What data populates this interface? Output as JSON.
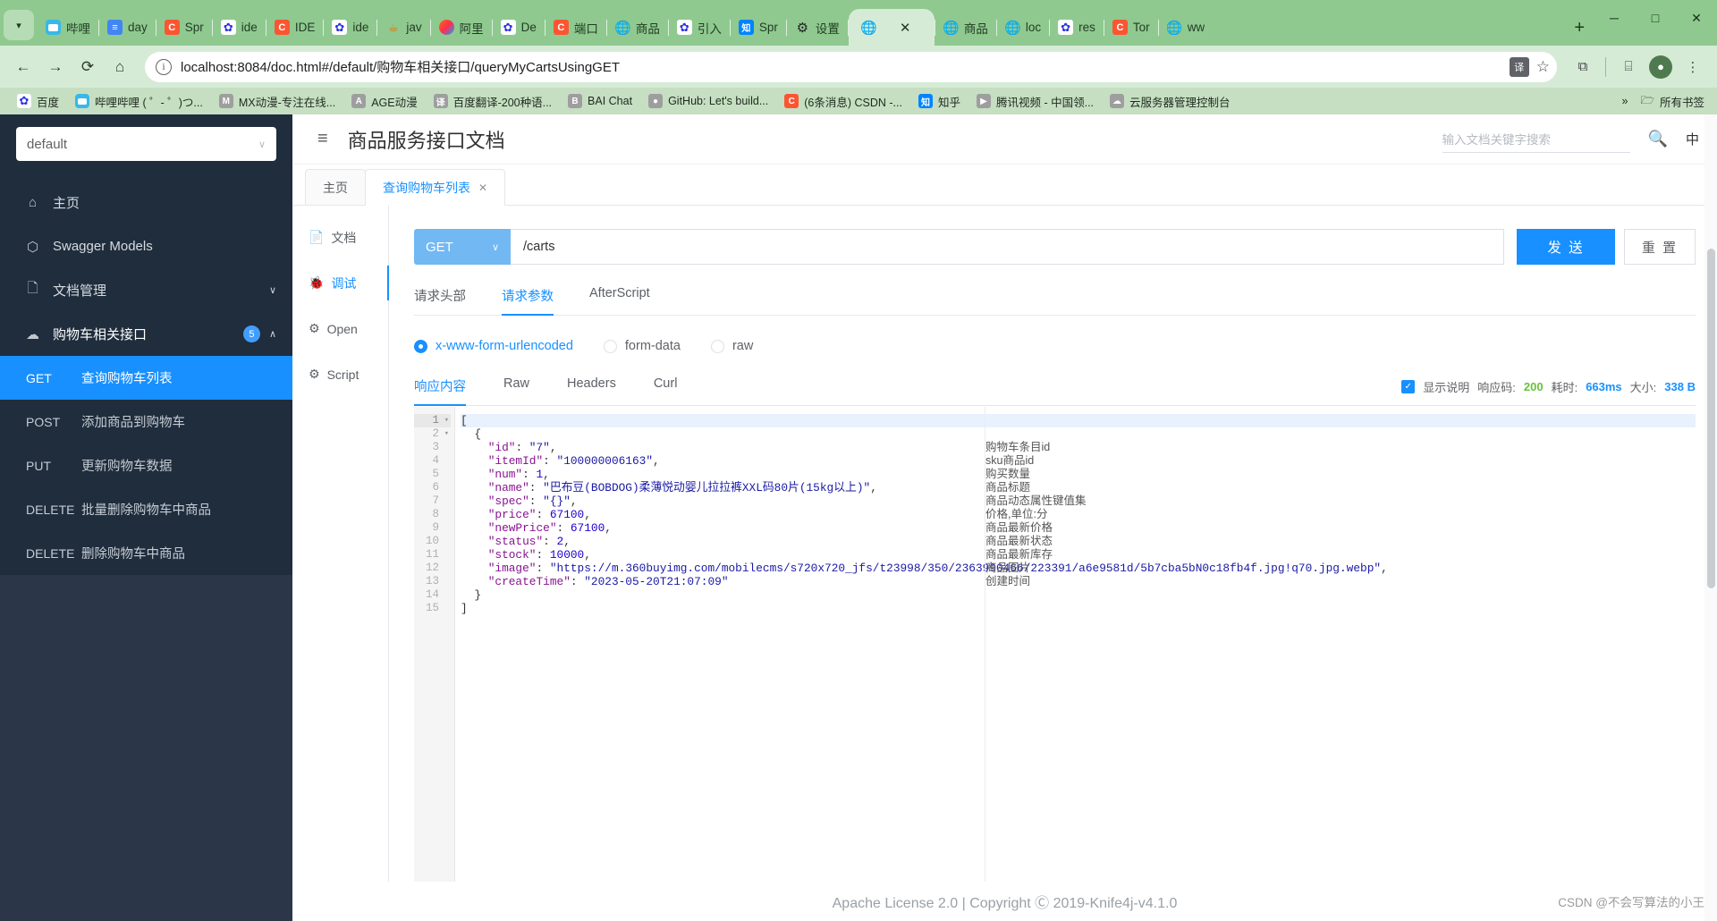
{
  "browser": {
    "tabs": [
      {
        "label": "哔哩",
        "icon": "bilibili-icon"
      },
      {
        "label": "day",
        "icon": "docs-icon"
      },
      {
        "label": "Spr",
        "icon": "csdn-icon"
      },
      {
        "label": "ide",
        "icon": "baidu-icon"
      },
      {
        "label": "IDE",
        "icon": "csdn-icon"
      },
      {
        "label": "ide",
        "icon": "baidu-icon"
      },
      {
        "label": "jav",
        "icon": "java-icon"
      },
      {
        "label": "阿里",
        "icon": "alibaba-icon"
      },
      {
        "label": "De",
        "icon": "baidu-icon"
      },
      {
        "label": "端口",
        "icon": "csdn-icon"
      },
      {
        "label": "商品",
        "icon": "globe-icon"
      },
      {
        "label": "引入",
        "icon": "baidu-icon"
      },
      {
        "label": "Spr",
        "icon": "zhihu-icon"
      },
      {
        "label": "设置",
        "icon": "gear-icon"
      },
      {
        "label": "",
        "icon": "globe-icon",
        "active": true
      },
      {
        "label": "商品",
        "icon": "globe-icon"
      },
      {
        "label": "loc",
        "icon": "globe-icon"
      },
      {
        "label": "res",
        "icon": "baidu-icon"
      },
      {
        "label": "Tor",
        "icon": "csdn-icon"
      },
      {
        "label": "ww",
        "icon": "globe-icon"
      }
    ],
    "new_tab_label": "+",
    "window_controls": {
      "minimize": "─",
      "maximize": "□",
      "close": "✕"
    },
    "nav": {
      "back": "←",
      "forward": "→",
      "reload": "⟳",
      "home": "⌂",
      "url": "localhost:8084/doc.html#/default/购物车相关接口/queryMyCartsUsingGET",
      "translate_label": "译",
      "bookmark_star": "☆",
      "extensions": "⧉",
      "sidepanel": "⌸",
      "profile": "●",
      "menu": "⋮"
    },
    "bookmarks": [
      {
        "label": "百度",
        "icon": "baidu-icon"
      },
      {
        "label": "哔哩哔哩 ( ゜- ゜)つ...",
        "icon": "bilibili-icon"
      },
      {
        "label": "MX动漫-专注在线...",
        "icon": "mx-icon"
      },
      {
        "label": "AGE动漫",
        "icon": "age-icon"
      },
      {
        "label": "百度翻译-200种语...",
        "icon": "fanyi-icon"
      },
      {
        "label": "BAI Chat",
        "icon": "bai-icon"
      },
      {
        "label": "GitHub: Let's build...",
        "icon": "github-icon"
      },
      {
        "label": "(6条消息) CSDN -...",
        "icon": "csdn-icon"
      },
      {
        "label": "知乎",
        "icon": "zhihu-icon"
      },
      {
        "label": "腾讯视频 - 中国领...",
        "icon": "tencent-icon"
      },
      {
        "label": "云服务器管理控制台",
        "icon": "aliyun-icon"
      }
    ],
    "bookmarks_overflow": "»",
    "bookmarks_folder": "所有书签"
  },
  "sidebar": {
    "service_select": {
      "value": "default",
      "caret": "∨"
    },
    "menu": [
      {
        "label": "主页",
        "icon": "home-icon"
      },
      {
        "label": "Swagger Models",
        "icon": "cube-icon"
      },
      {
        "label": "文档管理",
        "icon": "doc-manage-icon",
        "caret": "∨"
      },
      {
        "label": "购物车相关接口",
        "icon": "cloud-icon",
        "badge": "5",
        "caret": "∧",
        "expanded": true
      }
    ],
    "apis": [
      {
        "verb": "GET",
        "label": "查询购物车列表",
        "selected": true
      },
      {
        "verb": "POST",
        "label": "添加商品到购物车",
        "selected": false
      },
      {
        "verb": "PUT",
        "label": "更新购物车数据",
        "selected": false
      },
      {
        "verb": "DELETE",
        "label": "批量删除购物车中商品",
        "selected": false
      },
      {
        "verb": "DELETE",
        "label": "删除购物车中商品",
        "selected": false
      }
    ]
  },
  "header": {
    "collapse_icon": "≡",
    "title": "商品服务接口文档",
    "search_placeholder": "输入文档关键字搜索",
    "search_icon": "search-icon",
    "lang_label": "中"
  },
  "doc_tabs": [
    {
      "label": "主页",
      "active": false,
      "closable": false
    },
    {
      "label": "查询购物车列表",
      "active": true,
      "closable": true,
      "close": "✕"
    }
  ],
  "vtabs": [
    {
      "label": "文档",
      "icon": "document-icon",
      "active": false
    },
    {
      "label": "调试",
      "icon": "bug-icon",
      "active": true
    },
    {
      "label": "Open",
      "icon": "open-icon",
      "active": false
    },
    {
      "label": "Script",
      "icon": "script-icon",
      "active": false
    }
  ],
  "request": {
    "method": "GET",
    "method_caret": "∨",
    "path": "/carts",
    "send_label": "发 送",
    "reset_label": "重 置"
  },
  "request_tabs": [
    {
      "label": "请求头部",
      "active": false
    },
    {
      "label": "请求参数",
      "active": true
    },
    {
      "label": "AfterScript",
      "active": false
    }
  ],
  "body_types": [
    {
      "label": "x-www-form-urlencoded",
      "selected": true
    },
    {
      "label": "form-data",
      "selected": false
    },
    {
      "label": "raw",
      "selected": false
    }
  ],
  "response_tabs": [
    {
      "label": "响应内容",
      "active": true
    },
    {
      "label": "Raw",
      "active": false
    },
    {
      "label": "Headers",
      "active": false
    },
    {
      "label": "Curl",
      "active": false
    }
  ],
  "response_meta": {
    "show_desc_label": "显示说明",
    "show_desc_checked": true,
    "check_mark": "✓",
    "status_key": "响应码:",
    "status_value": "200",
    "time_key": "耗时:",
    "time_value": "663ms",
    "size_key": "大小:",
    "size_value": "338 B"
  },
  "response_body": {
    "lines": [
      {
        "no": "1",
        "fold": "▾",
        "highlight": true,
        "tokens": [
          {
            "t": "[",
            "c": "p"
          }
        ],
        "indent": 0
      },
      {
        "no": "2",
        "fold": "▾",
        "tokens": [
          {
            "t": "{",
            "c": "p"
          }
        ],
        "indent": 1
      },
      {
        "no": "3",
        "fold": "",
        "tokens": [
          {
            "t": "\"id\"",
            "c": "k"
          },
          {
            "t": ": ",
            "c": "p"
          },
          {
            "t": "\"7\"",
            "c": "s"
          },
          {
            "t": ",",
            "c": "p"
          }
        ],
        "indent": 2
      },
      {
        "no": "4",
        "fold": "",
        "tokens": [
          {
            "t": "\"itemId\"",
            "c": "k"
          },
          {
            "t": ": ",
            "c": "p"
          },
          {
            "t": "\"100000006163\"",
            "c": "s"
          },
          {
            "t": ",",
            "c": "p"
          }
        ],
        "indent": 2
      },
      {
        "no": "5",
        "fold": "",
        "tokens": [
          {
            "t": "\"num\"",
            "c": "k"
          },
          {
            "t": ": ",
            "c": "p"
          },
          {
            "t": "1",
            "c": "n"
          },
          {
            "t": ",",
            "c": "p"
          }
        ],
        "indent": 2
      },
      {
        "no": "6",
        "fold": "",
        "tokens": [
          {
            "t": "\"name\"",
            "c": "k"
          },
          {
            "t": ": ",
            "c": "p"
          },
          {
            "t": "\"巴布豆(BOBDOG)柔薄悦动婴儿拉拉裤XXL码80片(15kg以上)\"",
            "c": "s"
          },
          {
            "t": ",",
            "c": "p"
          }
        ],
        "indent": 2
      },
      {
        "no": "7",
        "fold": "",
        "tokens": [
          {
            "t": "\"spec\"",
            "c": "k"
          },
          {
            "t": ": ",
            "c": "p"
          },
          {
            "t": "\"{}\"",
            "c": "s"
          },
          {
            "t": ",",
            "c": "p"
          }
        ],
        "indent": 2
      },
      {
        "no": "8",
        "fold": "",
        "tokens": [
          {
            "t": "\"price\"",
            "c": "k"
          },
          {
            "t": ": ",
            "c": "p"
          },
          {
            "t": "67100",
            "c": "n"
          },
          {
            "t": ",",
            "c": "p"
          }
        ],
        "indent": 2
      },
      {
        "no": "9",
        "fold": "",
        "tokens": [
          {
            "t": "\"newPrice\"",
            "c": "k"
          },
          {
            "t": ": ",
            "c": "p"
          },
          {
            "t": "67100",
            "c": "n"
          },
          {
            "t": ",",
            "c": "p"
          }
        ],
        "indent": 2
      },
      {
        "no": "10",
        "fold": "",
        "tokens": [
          {
            "t": "\"status\"",
            "c": "k"
          },
          {
            "t": ": ",
            "c": "p"
          },
          {
            "t": "2",
            "c": "n"
          },
          {
            "t": ",",
            "c": "p"
          }
        ],
        "indent": 2
      },
      {
        "no": "11",
        "fold": "",
        "tokens": [
          {
            "t": "\"stock\"",
            "c": "k"
          },
          {
            "t": ": ",
            "c": "p"
          },
          {
            "t": "10000",
            "c": "n"
          },
          {
            "t": ",",
            "c": "p"
          }
        ],
        "indent": 2
      },
      {
        "no": "12",
        "fold": "",
        "tokens": [
          {
            "t": "\"image\"",
            "c": "k"
          },
          {
            "t": ": ",
            "c": "p"
          },
          {
            "t": "\"https://m.360buyimg.com/mobilecms/s720x720_jfs/t23998/350/2363990466/223391/a6e9581d/5b7cba5bN0c18fb4f.jpg!q70.jpg.webp\"",
            "c": "s"
          },
          {
            "t": ",",
            "c": "p"
          }
        ],
        "indent": 2
      },
      {
        "no": "13",
        "fold": "",
        "tokens": [
          {
            "t": "\"createTime\"",
            "c": "k"
          },
          {
            "t": ": ",
            "c": "p"
          },
          {
            "t": "\"2023-05-20T21:07:09\"",
            "c": "s"
          }
        ],
        "indent": 2
      },
      {
        "no": "14",
        "fold": "",
        "tokens": [
          {
            "t": "}",
            "c": "p"
          }
        ],
        "indent": 1
      },
      {
        "no": "15",
        "fold": "",
        "tokens": [
          {
            "t": "]",
            "c": "p"
          }
        ],
        "indent": 0
      }
    ],
    "annotations": [
      "",
      "",
      "购物车条目id",
      "sku商品id",
      "购买数量",
      "商品标题",
      "商品动态属性键值集",
      "价格,单位:分",
      "商品最新价格",
      "商品最新状态",
      "商品最新库存",
      "商品图片",
      "创建时间",
      "",
      ""
    ]
  },
  "footer": {
    "text": "Apache License 2.0 | Copyright Ⓒ 2019-Knife4j-v4.1.0"
  },
  "watermark": "CSDN @不会写算法的小王"
}
